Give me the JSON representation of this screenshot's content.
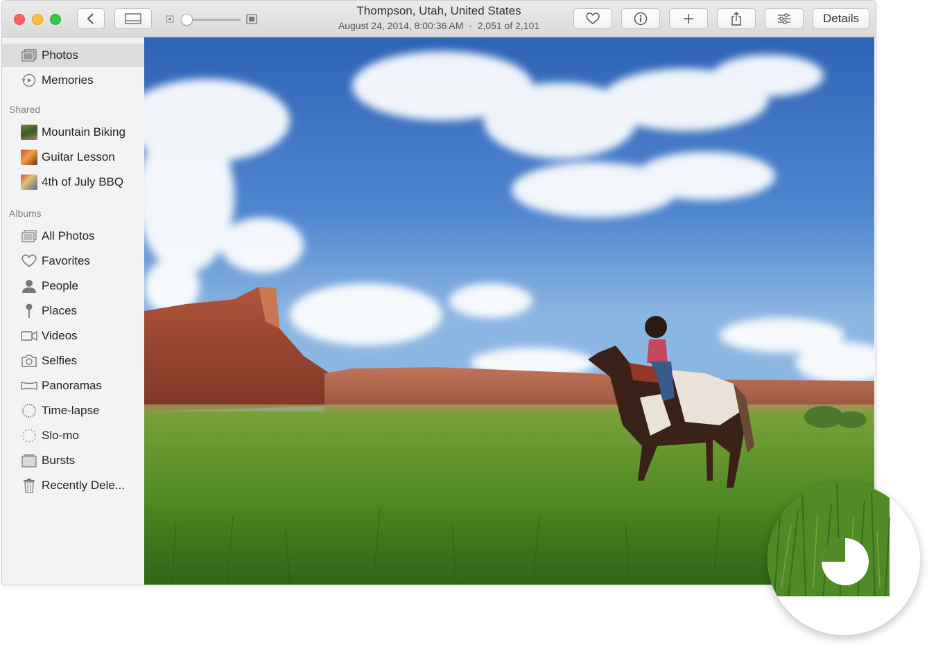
{
  "window": {
    "title": "Thompson, Utah, United States",
    "subtitle": "August 24, 2014, 8:00:36 AM  ·  2,051 of 2,101",
    "details_label": "Details"
  },
  "toolbar": {
    "back_icon": "chevron-left-icon",
    "split_view_icon": "split-view-icon",
    "zoom_slider_value": 0.0,
    "favorite_icon": "heart-icon",
    "info_icon": "info-icon",
    "add_icon": "plus-icon",
    "share_icon": "share-icon",
    "adjust_icon": "sliders-icon"
  },
  "sidebar": {
    "library": [
      {
        "label": "Photos",
        "icon": "photos-icon",
        "selected": true
      },
      {
        "label": "Memories",
        "icon": "memories-icon",
        "selected": false
      }
    ],
    "shared_header": "Shared",
    "shared": [
      {
        "label": "Mountain Biking",
        "icon": "album-thumbnail"
      },
      {
        "label": "Guitar Lesson",
        "icon": "album-thumbnail"
      },
      {
        "label": "4th of July BBQ",
        "icon": "album-thumbnail"
      }
    ],
    "albums_header": "Albums",
    "albums": [
      {
        "label": "All Photos",
        "icon": "photos-icon"
      },
      {
        "label": "Favorites",
        "icon": "heart-icon"
      },
      {
        "label": "People",
        "icon": "person-icon"
      },
      {
        "label": "Places",
        "icon": "pin-icon"
      },
      {
        "label": "Videos",
        "icon": "video-camera-icon"
      },
      {
        "label": "Selfies",
        "icon": "camera-icon"
      },
      {
        "label": "Panoramas",
        "icon": "panorama-icon"
      },
      {
        "label": "Time-lapse",
        "icon": "time-lapse-icon"
      },
      {
        "label": "Slo-mo",
        "icon": "slo-mo-icon"
      },
      {
        "label": "Bursts",
        "icon": "bursts-icon"
      },
      {
        "label": "Recently Dele...",
        "icon": "trash-icon"
      }
    ]
  },
  "magnifier": {
    "icon": "upload-progress-pie-icon",
    "progress": 0.25
  }
}
